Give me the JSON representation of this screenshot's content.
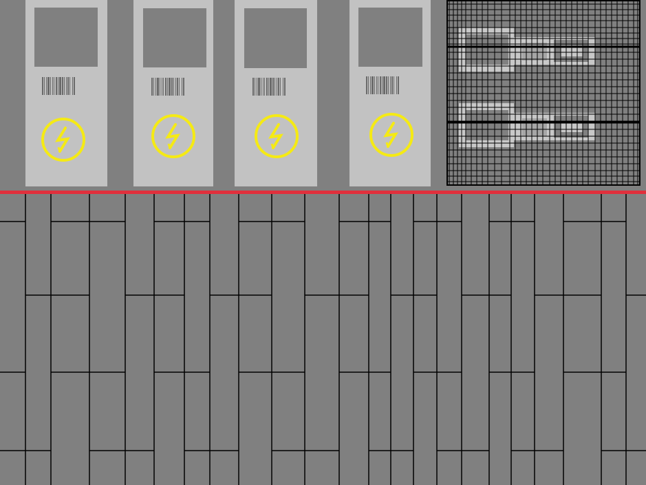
{
  "scene": {
    "wall_color": "#808080",
    "panel_color": "#c2c2c2",
    "floor_color": "#808080",
    "divider_color": "#e0303c",
    "bolt_color": "#f5ea14",
    "grid_line_color": "#000000"
  },
  "stations": [
    {
      "id": "station-1",
      "icon": "lightning-bolt-icon",
      "barcode": "barcode-label"
    },
    {
      "id": "station-2",
      "icon": "lightning-bolt-icon",
      "barcode": "barcode-label"
    },
    {
      "id": "station-3",
      "icon": "lightning-bolt-icon",
      "barcode": "barcode-label"
    },
    {
      "id": "station-4",
      "icon": "lightning-bolt-icon",
      "barcode": "barcode-label"
    }
  ],
  "wall_sign": {
    "icon": "blueprint-grid-sign"
  }
}
